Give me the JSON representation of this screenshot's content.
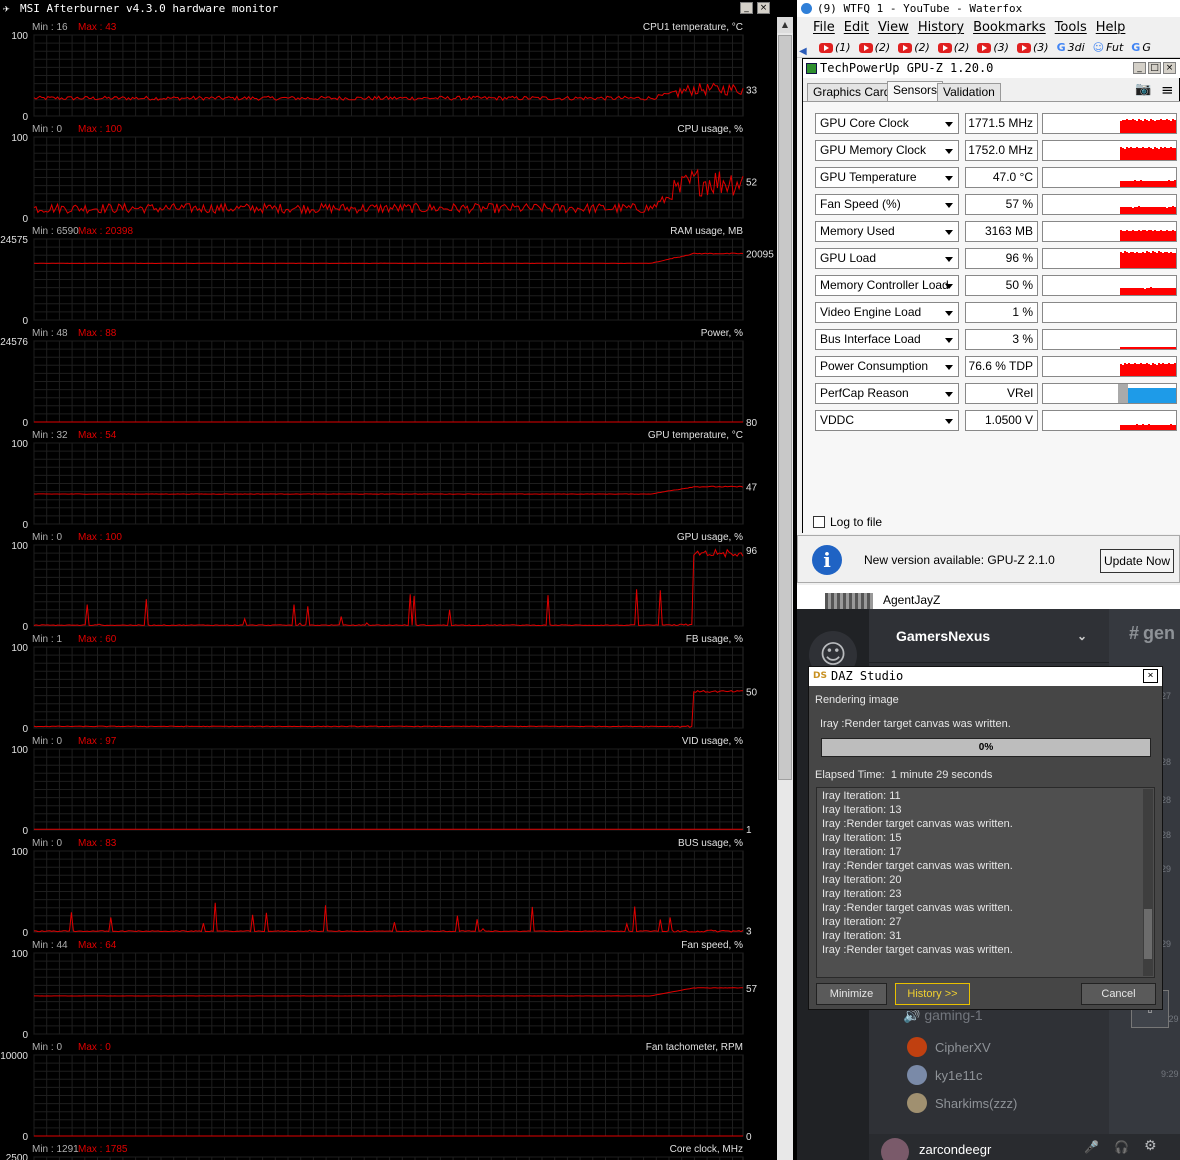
{
  "afterburner": {
    "title": "MSI Afterburner v4.3.0 hardware monitor",
    "line_color": "#e00000",
    "graphs": [
      {
        "name": "CPU1 temperature, °C",
        "min_label": "Min : 16",
        "max_label": "Max : 43",
        "axis_top": "100",
        "axis_bottom": "0",
        "current": "33",
        "level": 0.22,
        "end_level": 0.33,
        "noise": 0.025,
        "spike": 0.0,
        "trend": "late-rise"
      },
      {
        "name": "CPU usage, %",
        "min_label": "Min : 0",
        "max_label": "Max : 100",
        "axis_top": "100",
        "axis_bottom": "0",
        "current": "52",
        "level": 0.12,
        "end_level": 0.45,
        "noise": 0.06,
        "spike": 0.0,
        "trend": "late-rise"
      },
      {
        "name": "RAM usage, MB",
        "min_label": "Min : 6590",
        "max_label": "Max : 20398",
        "axis_top": "24575",
        "axis_bottom": "0",
        "current": "20095",
        "level": 0.7,
        "end_level": 0.82,
        "noise": 0.002,
        "spike": 0.0,
        "trend": "late-rise"
      },
      {
        "name": "Power, %",
        "min_label": "Min : 48",
        "max_label": "Max : 88",
        "axis_top": "24576",
        "axis_bottom": "0",
        "current": "80",
        "level": 0.0,
        "end_level": 0.0,
        "noise": 0.0,
        "spike": 0.0,
        "trend": "flat"
      },
      {
        "name": "GPU temperature, °C",
        "min_label": "Min : 32",
        "max_label": "Max : 54",
        "axis_top": "100",
        "axis_bottom": "0",
        "current": "47",
        "level": 0.37,
        "end_level": 0.46,
        "noise": 0.002,
        "spike": 0.0,
        "trend": "late-rise"
      },
      {
        "name": "GPU usage, %",
        "min_label": "Min : 0",
        "max_label": "Max : 100",
        "axis_top": "100",
        "axis_bottom": "0",
        "current": "96",
        "level": 0.01,
        "end_level": 0.94,
        "noise": 0.005,
        "spike": 0.5,
        "trend": "late-jump"
      },
      {
        "name": "FB usage, %",
        "min_label": "Min : 1",
        "max_label": "Max : 60",
        "axis_top": "100",
        "axis_bottom": "0",
        "current": "50",
        "level": 0.02,
        "end_level": 0.45,
        "noise": 0.004,
        "spike": 0.0,
        "trend": "late-jump"
      },
      {
        "name": "VID usage, %",
        "min_label": "Min : 0",
        "max_label": "Max : 97",
        "axis_top": "100",
        "axis_bottom": "0",
        "current": "1",
        "level": 0.01,
        "end_level": 0.01,
        "noise": 0.0,
        "spike": 0.0,
        "trend": "flat"
      },
      {
        "name": "BUS usage, %",
        "min_label": "Min : 0",
        "max_label": "Max : 83",
        "axis_top": "100",
        "axis_bottom": "0",
        "current": "3",
        "level": 0.01,
        "end_level": 0.02,
        "noise": 0.005,
        "spike": 0.35,
        "trend": "spiky"
      },
      {
        "name": "Fan speed, %",
        "min_label": "Min : 44",
        "max_label": "Max : 64",
        "axis_top": "100",
        "axis_bottom": "0",
        "current": "57",
        "level": 0.47,
        "end_level": 0.57,
        "noise": 0.001,
        "spike": 0.0,
        "trend": "late-rise"
      },
      {
        "name": "Fan tachometer, RPM",
        "min_label": "Min : 0",
        "max_label": "Max : 0",
        "axis_top": "10000",
        "axis_bottom": "0",
        "current": "0",
        "level": 0.0,
        "end_level": 0.0,
        "noise": 0.0,
        "spike": 0.0,
        "trend": "flat"
      },
      {
        "name": "Core clock, MHz",
        "min_label": "Min : 1291",
        "max_label": "Max : 1785",
        "axis_top": "2500",
        "axis_bottom": "",
        "current": "",
        "level": 0.0,
        "end_level": 0.0,
        "noise": 0.0,
        "spike": 0.0,
        "trend": "none"
      }
    ]
  },
  "waterfox": {
    "title": "(9) WTFQ 1 - YouTube - Waterfox",
    "menu": [
      "File",
      "Edit",
      "View",
      "History",
      "Bookmarks",
      "Tools",
      "Help"
    ],
    "tabs": [
      "(1)",
      "(2)",
      "(2)",
      "(2)",
      "(3)",
      "(3)",
      "3di",
      "Fut",
      "G"
    ]
  },
  "gpuz": {
    "title": "TechPowerUp GPU-Z 1.20.0",
    "tabs": [
      "Graphics Card",
      "Sensors",
      "Validation"
    ],
    "active_tab": "Sensors",
    "sensors": [
      {
        "name": "GPU Core Clock",
        "value": "1771.5 MHz",
        "fill": 0.75
      },
      {
        "name": "GPU Memory Clock",
        "value": "1752.0 MHz",
        "fill": 0.7
      },
      {
        "name": "GPU Temperature",
        "value": "47.0 °C",
        "fill": 0.35
      },
      {
        "name": "Fan Speed (%)",
        "value": "57 %",
        "fill": 0.4
      },
      {
        "name": "Memory Used",
        "value": "3163 MB",
        "fill": 0.6
      },
      {
        "name": "GPU Load",
        "value": "96 %",
        "fill": 0.9
      },
      {
        "name": "Memory Controller Load",
        "value": "50 %",
        "fill": 0.4
      },
      {
        "name": "Video Engine Load",
        "value": "1 %",
        "fill": 0.0
      },
      {
        "name": "Bus Interface Load",
        "value": "3 %",
        "fill": 0.1
      },
      {
        "name": "Power Consumption",
        "value": "76.6 % TDP",
        "fill": 0.7
      },
      {
        "name": "PerfCap Reason",
        "value": "VRel",
        "fill": 0.8
      },
      {
        "name": "VDDC",
        "value": "1.0500 V",
        "fill": 0.3
      }
    ],
    "log_label": "Log to file",
    "update_message": "New version available: GPU-Z 2.1.0",
    "update_button": "Update Now"
  },
  "discord": {
    "top_name": "AgentJayZ",
    "server": "GamersNexus",
    "channel": "gen",
    "voice_channel": "gaming-1",
    "voice_users": [
      "CipherXV",
      "ky1e11c",
      "Sharkims(zzz)"
    ],
    "timestamps": [
      "27",
      "28",
      "28",
      "28",
      "29",
      "29",
      "9:29",
      "9:29"
    ],
    "self_user": "zarcondeegr"
  },
  "daz": {
    "title": "DAZ Studio",
    "status": "Rendering image",
    "last_message": "Iray :Render target canvas was written.",
    "progress_text": "0%",
    "progress": 0.0,
    "elapsed_label": "Elapsed Time:",
    "elapsed_value": "1 minute 29 seconds",
    "log": [
      "Iray Iteration: 11",
      "Iray Iteration: 13",
      "Iray :Render target canvas was written.",
      "Iray Iteration: 15",
      "Iray Iteration: 17",
      "Iray :Render target canvas was written.",
      "Iray Iteration: 20",
      "Iray Iteration: 23",
      "Iray :Render target canvas was written.",
      "Iray Iteration: 27",
      "Iray Iteration: 31",
      "Iray :Render target canvas was written."
    ],
    "buttons": {
      "minimize": "Minimize",
      "history": "History >>",
      "cancel": "Cancel"
    }
  }
}
